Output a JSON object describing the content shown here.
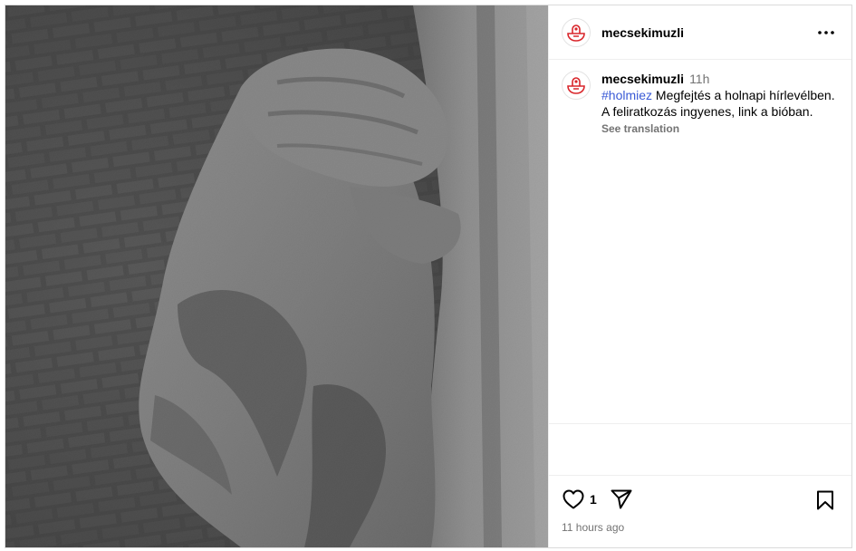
{
  "post": {
    "username": "mecsekimuzli",
    "image_description_icon": "statue-hand-photo"
  },
  "header": {
    "username": "mecsekimuzli",
    "more_icon": "more-horizontal-icon"
  },
  "caption": {
    "username": "mecsekimuzli",
    "time": "11h",
    "hashtag": "#holmiez",
    "text": " Megfejtés a holnapi hírlevélben. A feliratkozás ingyenes, link a bióban.",
    "see_translation": "See translation"
  },
  "actions": {
    "like_icon": "heart-icon",
    "like_count": "1",
    "share_icon": "send-icon",
    "save_icon": "bookmark-icon",
    "timestamp": "11 hours ago"
  },
  "colors": {
    "hashtag": "#3a5ad6",
    "secondary_text": "#737373",
    "border": "#dbdbdb",
    "avatar_red": "#d9262b"
  }
}
